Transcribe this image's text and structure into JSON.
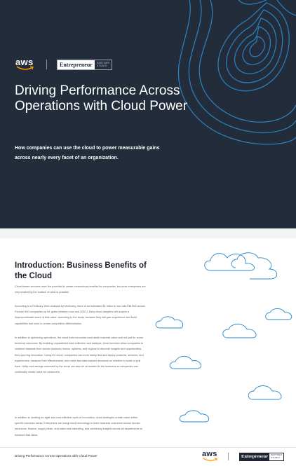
{
  "cover": {
    "aws_logo": "aws",
    "partner_badge": {
      "name": "Entrepreneur",
      "sub_line1": "PARTNER",
      "sub_line2": "STUDIO"
    },
    "title": "Driving Performance Across Operations with Cloud Power",
    "subtitle": "How companies can use the cloud to power measurable gains across nearly every facet of an organization.",
    "background_color": "#222c3a",
    "contour_color": "#2d87c7"
  },
  "intro": {
    "heading": "Introduction: Business Benefits of the Cloud",
    "paragraphs": [
      "Cloud-based services have the potential to create tremendous benefits for companies, but most enterprises are only scratching the surface of what is possible.",
      "According to a February 2021 analysis by McKinsey, there is an estimated $1 trillion in run-rate EBITDA across Fortune 500 companies up for grabs between now and 2030.1 Early cloud adopters will acquire a disproportionate share of that value, according to the study, because they will gain experience and build capabilities that work to create competitive differentiation.",
      "In addition to optimizing operations, the cloud fuels innovation and adds business value and not just for some technical outcomes. By enabling unparalleled data collection and analysis, cloud services allow companies to combine datasets from across products, teams, systems, and regions to discover insights and opportunities, thus spurring innovation. Using the cloud, companies can more easily test and deploy products, services, and experiences; measure their effectiveness; and make fast data-backed decisions on whether to scale or pull back. Hefty cost savings unlocked by the cloud can also be reinvested in the business so companies can continually create value for customers.",
      "In addition to creating an agile and cost-effective cycle of innovation, cloud strategies create value within specific business areas. Enterprises are using cloud technology to drive business outcomes across human resources, finance, supply chain, and sales and marketing, and combining insights across all departments to enhance that value."
    ]
  },
  "footer": {
    "title": "Driving Performance Across Operations with Cloud Power",
    "aws_logo": "aws",
    "partner_badge": {
      "name": "Entrepreneur",
      "sub_line1": "PARTNER",
      "sub_line2": "STUDIO"
    }
  },
  "icons": [
    "aws-smile-icon",
    "contour-lines-graphic",
    "cloud-icon"
  ]
}
